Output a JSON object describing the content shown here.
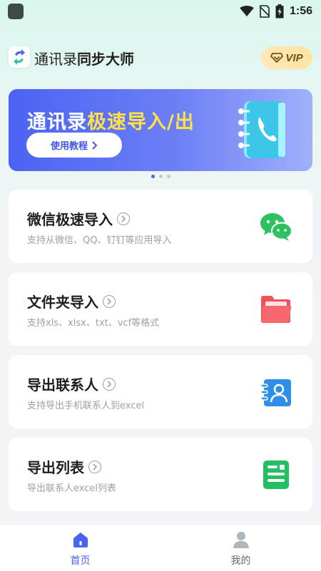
{
  "status_bar": {
    "time": "1:56",
    "icons": [
      "wifi-icon",
      "no-sim-icon",
      "battery-charging-icon"
    ]
  },
  "header": {
    "title_regular": "通讯录",
    "title_bold": "同步大师",
    "vip_label": "VIP"
  },
  "banner": {
    "title_white": "通讯录",
    "title_highlight": "极速导入/出",
    "button_label": "使用教程",
    "highlight_color": "#ffe14a",
    "page_count": 3,
    "active_page": 1
  },
  "cards": [
    {
      "title": "微信极速导入",
      "subtitle": "支持从微信、QQ、钉钉等应用导入",
      "icon": "wechat-icon"
    },
    {
      "title": "文件夹导入",
      "subtitle": "支持xls、xlsx、txt、vcf等格式",
      "icon": "folder-icon"
    },
    {
      "title": "导出联系人",
      "subtitle": "支持导出手机联系人到excel",
      "icon": "contact-card-icon"
    },
    {
      "title": "导出列表",
      "subtitle": "导出联系人excel列表",
      "icon": "list-document-icon"
    }
  ],
  "bottom_nav": [
    {
      "label": "首页",
      "icon": "home-icon",
      "active": true
    },
    {
      "label": "我的",
      "icon": "person-icon",
      "active": false
    }
  ],
  "colors": {
    "accent": "#4b63f3",
    "wechat": "#2dc160",
    "folder": "#f2535a",
    "contact": "#2f8ee8",
    "list": "#22bf63"
  }
}
